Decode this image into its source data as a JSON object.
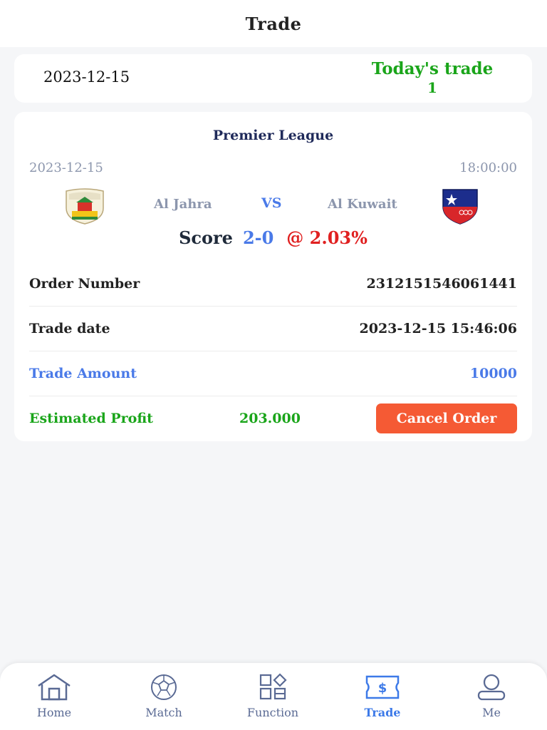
{
  "header": {
    "title": "Trade"
  },
  "summary": {
    "date": "2023-12-15",
    "today_label": "Today's trade",
    "today_count": "1"
  },
  "match": {
    "league": "Premier League",
    "date": "2023-12-15",
    "time": "18:00:00",
    "home_team": "Al Jahra",
    "vs": "VS",
    "away_team": "Al Kuwait",
    "score_label": "Score",
    "score": "2-0",
    "odds": "@ 2.03%"
  },
  "order": {
    "number_label": "Order Number",
    "number": "2312151546061441",
    "date_label": "Trade date",
    "date": "2023-12-15 15:46:06",
    "amount_label": "Trade Amount",
    "amount": "10000",
    "profit_label": "Estimated Profit",
    "profit": "203.000",
    "cancel_label": "Cancel Order"
  },
  "tabbar": {
    "items": [
      {
        "label": "Home",
        "icon": "home-icon"
      },
      {
        "label": "Match",
        "icon": "ball-icon"
      },
      {
        "label": "Function",
        "icon": "grid-icon"
      },
      {
        "label": "Trade",
        "icon": "ticket-icon",
        "active": true
      },
      {
        "label": "Me",
        "icon": "user-icon"
      }
    ]
  },
  "colors": {
    "accent_blue": "#4a7ae8",
    "green": "#1aa51a",
    "red": "#e02020",
    "cancel_button": "#f55a34",
    "league_navy": "#1f2a5a"
  }
}
